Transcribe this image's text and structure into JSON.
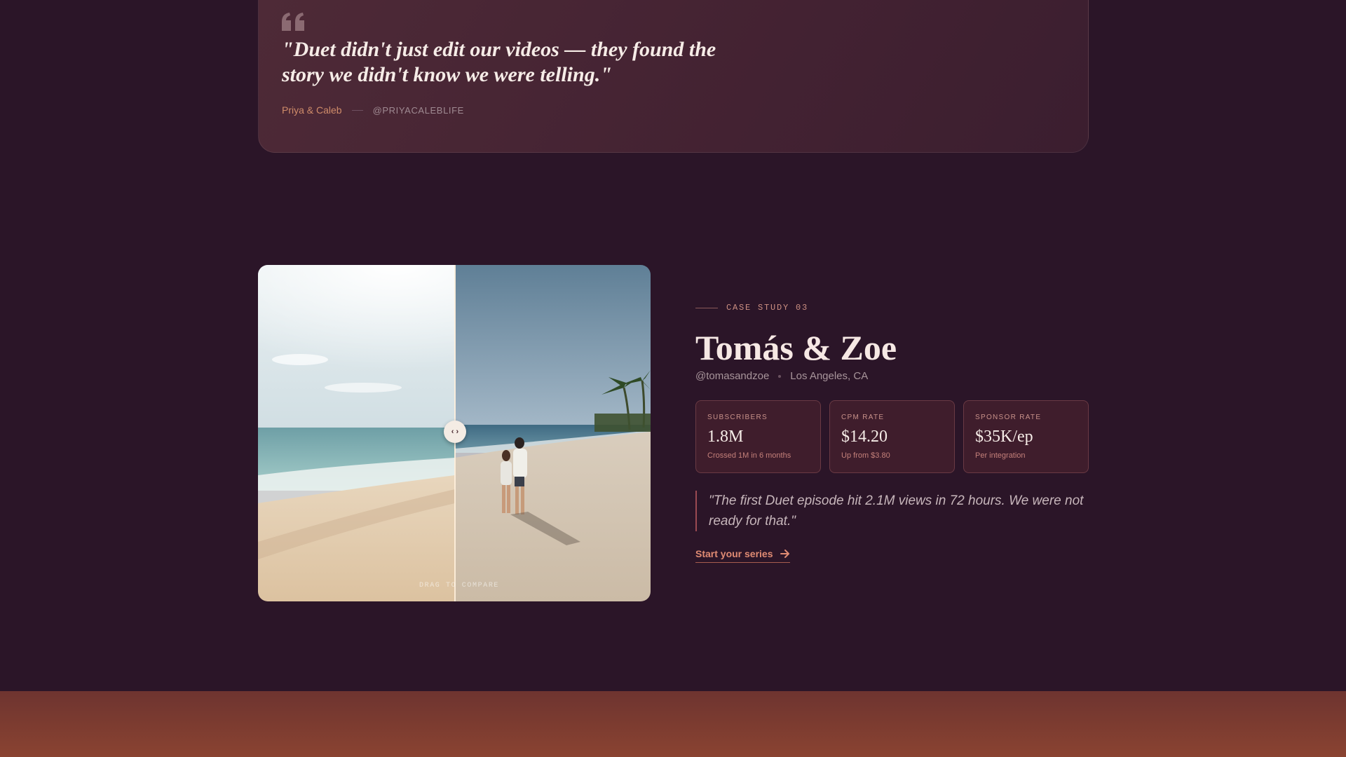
{
  "testimonial": {
    "quote": "\"Duet didn't just edit our videos — they found the story we didn't know we were telling.\"",
    "author": "Priya & Caleb",
    "handle": "@PRIYACALEBLIFE",
    "icon": "quote-icon"
  },
  "compare": {
    "hint": "DRAG TO COMPARE",
    "handle_icon": "arrows-horizontal-icon",
    "split_fraction": 0.5,
    "colors": {
      "divider": "#f4ece4"
    }
  },
  "case_study": {
    "eyebrow": "CASE STUDY 03",
    "title": "Tomás & Zoe",
    "handle": "@tomasandzoe",
    "location": "Los Angeles, CA",
    "stats": [
      {
        "label": "SUBSCRIBERS",
        "value": "1.8M",
        "note": "Crossed 1M in 6 months"
      },
      {
        "label": "CPM RATE",
        "value": "$14.20",
        "note": "Up from $3.80"
      },
      {
        "label": "SPONSOR RATE",
        "value": "$35K/ep",
        "note": "Per integration"
      }
    ],
    "quote": "\"The first Duet episode hit 2.1M views in 72 hours. We were not ready for that.\"",
    "cta_label": "Start your series",
    "cta_icon": "arrow-right-icon"
  },
  "colors": {
    "background": "#2b1528",
    "accent": "#e08b73",
    "card": "#4e2a37",
    "bottom_band": "#8a4331"
  }
}
